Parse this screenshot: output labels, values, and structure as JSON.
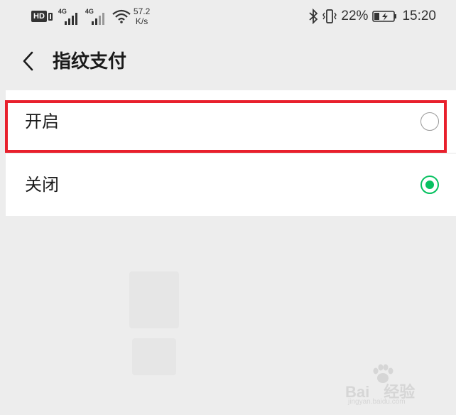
{
  "status_bar": {
    "hd_label": "HD",
    "sim1_network": "4G",
    "sim2_network": "4G",
    "speed_value": "57.2",
    "speed_unit": "K/s",
    "battery_percent": "22%",
    "time": "15:20",
    "icons": [
      "hd-icon",
      "signal-icon",
      "wifi-icon",
      "bluetooth-icon",
      "vibrate-icon",
      "battery-charging-icon"
    ]
  },
  "header": {
    "back_icon": "chevron-left-icon",
    "title": "指纹支付"
  },
  "options": [
    {
      "label": "开启",
      "selected": false
    },
    {
      "label": "关闭",
      "selected": true
    }
  ],
  "colors": {
    "accent": "#07c160",
    "highlight": "#e8202c",
    "background": "#ededed",
    "card": "#ffffff"
  },
  "watermark": {
    "brand": "Bai",
    "brand_suffix": "经验",
    "url": "jingyan.baidu.com"
  }
}
